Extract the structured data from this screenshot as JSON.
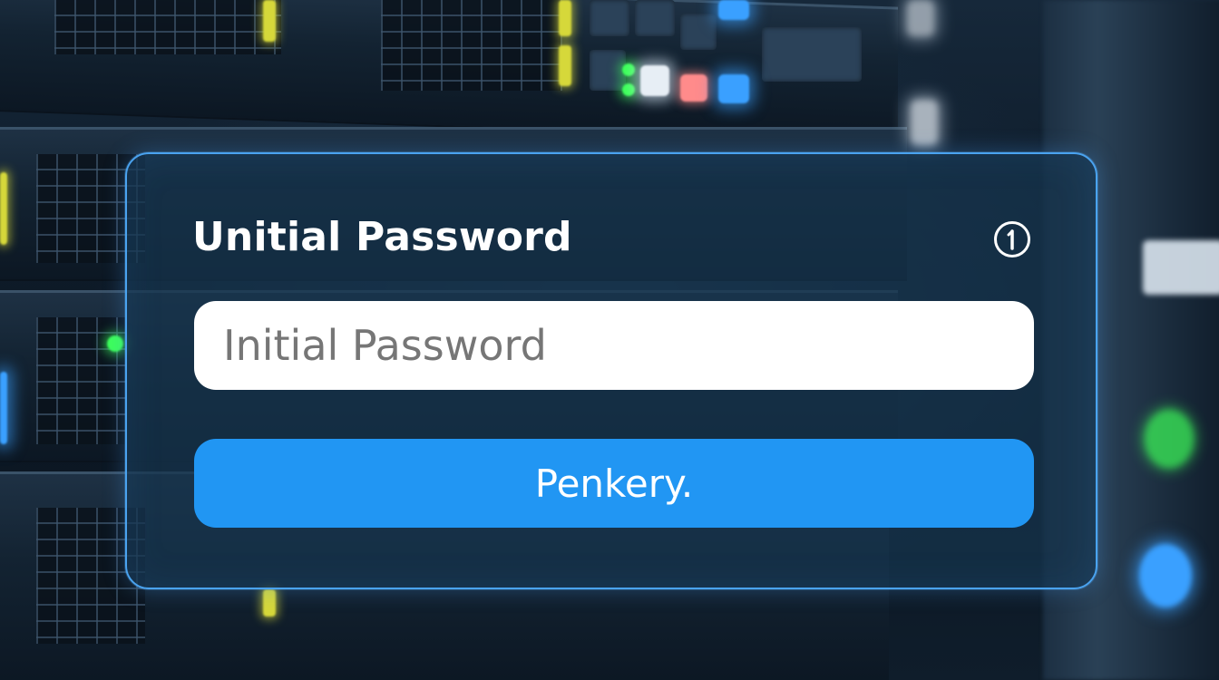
{
  "dialog": {
    "title": "Unitial Password",
    "info_icon": "info-icon",
    "input": {
      "value": "",
      "placeholder": "Initial Password"
    },
    "submit_label": "Penkery."
  },
  "colors": {
    "panel_border": "#4aa3f0",
    "button_bg": "#2196f3",
    "input_bg": "#ffffff"
  }
}
